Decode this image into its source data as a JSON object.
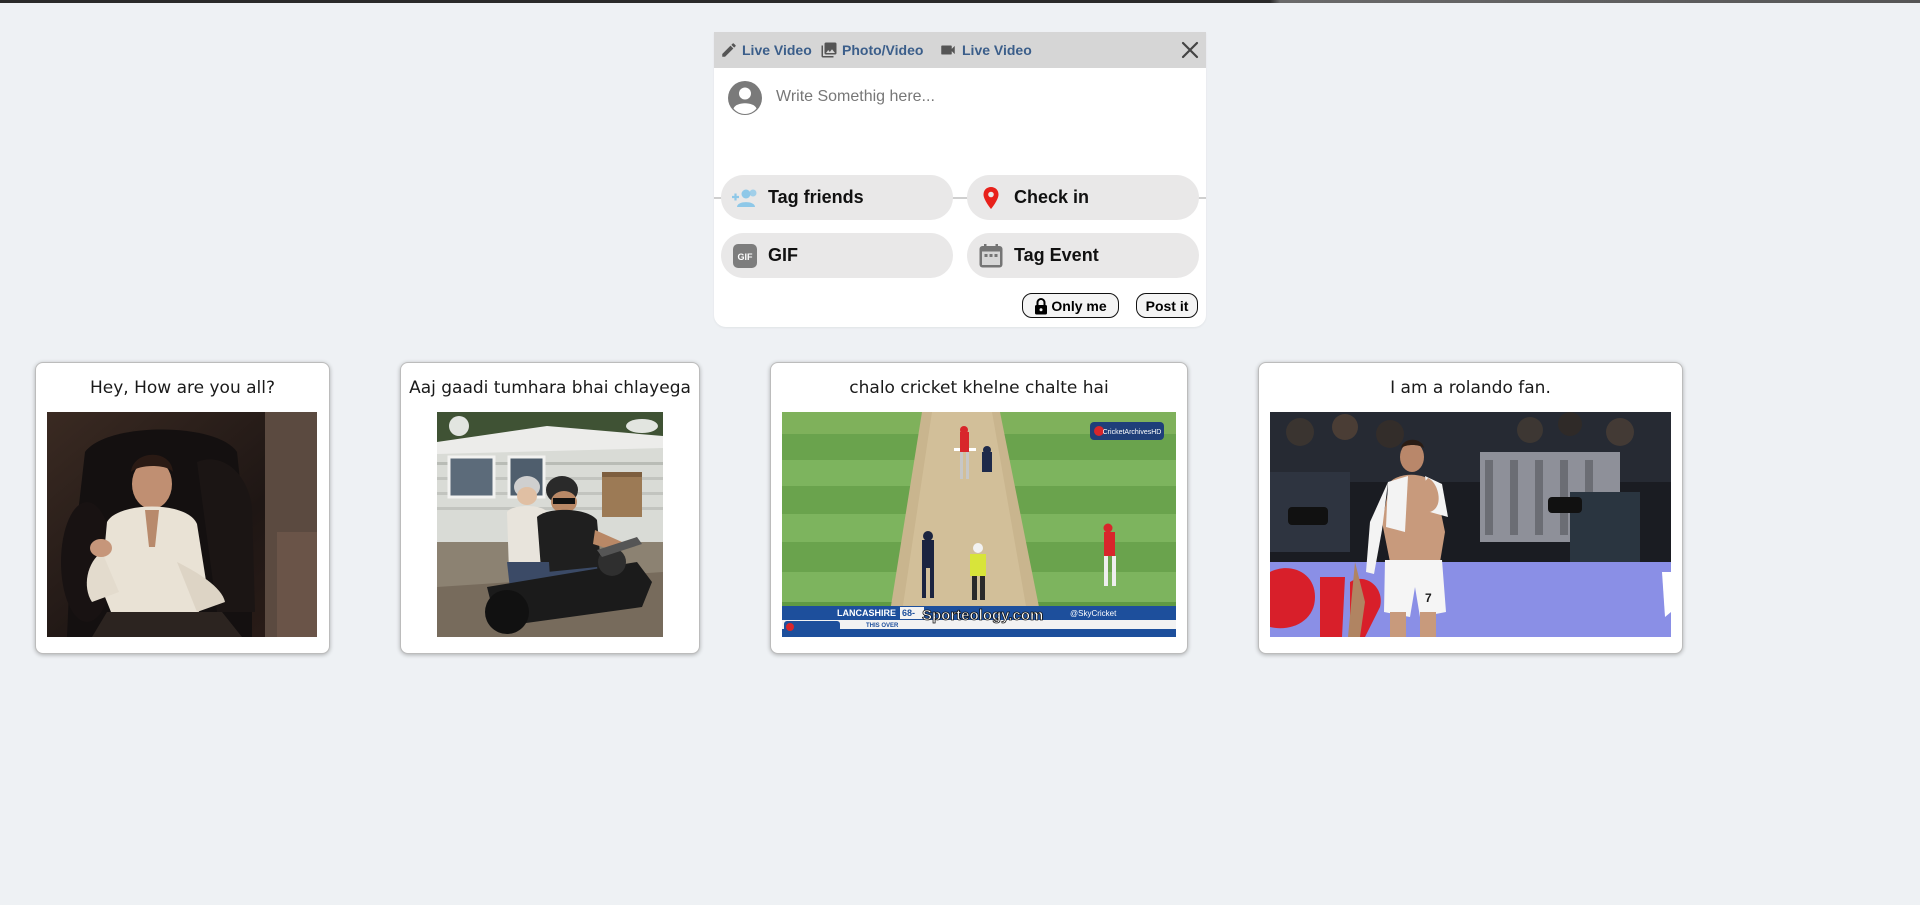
{
  "composer": {
    "header_options": [
      {
        "label": "Live Video",
        "icon": "pencil-icon"
      },
      {
        "label": "Photo/Video",
        "icon": "photo-icon"
      },
      {
        "label": "Live Video",
        "icon": "video-camera-icon"
      }
    ],
    "close_icon": "close-icon",
    "avatar_icon": "account-circle-icon",
    "input_placeholder": "Write Somethig here...",
    "input_value": "",
    "actions": [
      {
        "label": "Tag friends",
        "icon": "people-add-icon",
        "color": "#8ec8e8"
      },
      {
        "label": "Check in",
        "icon": "location-pin-icon",
        "color": "#e8211b"
      },
      {
        "label": "GIF",
        "icon": "gif-icon",
        "color": "#7d7d7d"
      },
      {
        "label": "Tag Event",
        "icon": "calendar-icon",
        "color": "#757575"
      }
    ],
    "privacy_label": "Only me",
    "privacy_icon": "lock-icon",
    "post_label": "Post it"
  },
  "posts": [
    {
      "caption": "Hey, How are you all?",
      "media": "gif-man-laughing-in-armchair"
    },
    {
      "caption": "Aaj gaadi tumhara bhai chlayega",
      "media": "gif-two-people-on-motorcycle"
    },
    {
      "caption": "chalo cricket khelne chalte hai",
      "media": "gif-cricket-match-broadcast",
      "overlay_texts": [
        "CricketArchivesHD",
        "LANCASHIRE",
        "68-",
        "@SkyCricket",
        "THIS OVER",
        "Sporteology.com"
      ]
    },
    {
      "caption": "I am a rolando fan.",
      "media": "gif-footballer-celebrating"
    }
  ],
  "colors": {
    "page_background": "#eef1f4",
    "header_link": "#3b5e8a",
    "pill_background": "#e9e8e8"
  }
}
